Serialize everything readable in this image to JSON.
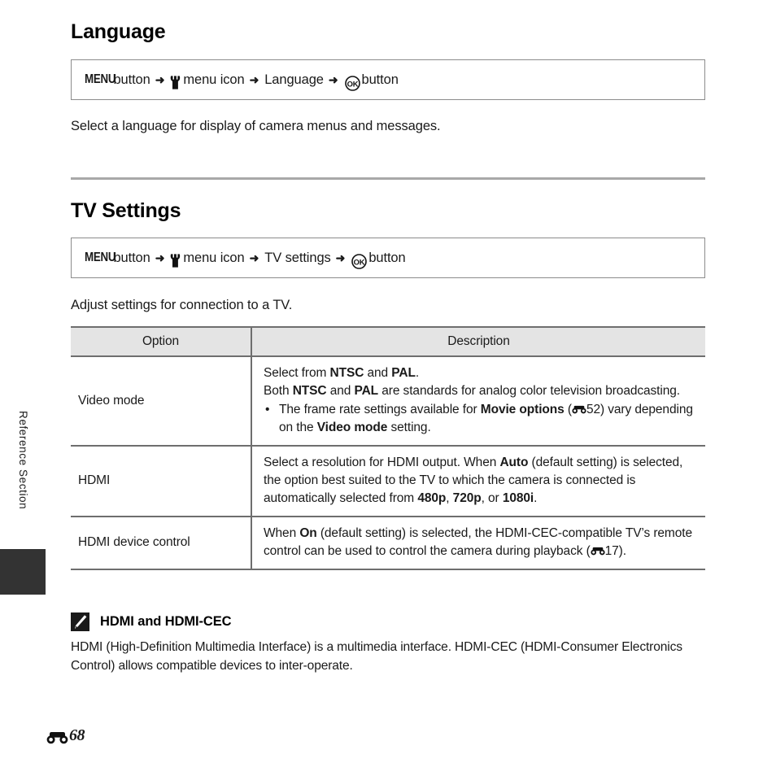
{
  "page": {
    "side_label": "Reference Section",
    "footer_page_number": "68",
    "footer_ref_icon": "reference-section-icon"
  },
  "sections": [
    {
      "id": "language",
      "title": "Language",
      "path": {
        "menu_label": "MENU",
        "button_word_1": "button",
        "wrench_icon": "setup-menu-wrench-icon",
        "menu_icon_label": "menu icon",
        "item_label": "Language",
        "ok_icon": "ok-button-icon",
        "button_word_2": "button",
        "arrow": "➜"
      },
      "description": "Select a language for display of camera menus and messages."
    },
    {
      "id": "tv-settings",
      "title": "TV Settings",
      "path": {
        "menu_label": "MENU",
        "button_word_1": "button",
        "wrench_icon": "setup-menu-wrench-icon",
        "menu_icon_label": "menu icon",
        "item_label": "TV settings",
        "ok_icon": "ok-button-icon",
        "button_word_2": "button",
        "arrow": "➜"
      },
      "description": "Adjust settings for connection to a TV."
    }
  ],
  "table": {
    "headers": [
      "Option",
      "Description"
    ],
    "rows": [
      {
        "option": "Video mode",
        "description_lines": [
          {
            "type": "para",
            "runs": [
              {
                "t": "Select from ",
                "b": false
              },
              {
                "t": "NTSC",
                "b": true
              },
              {
                "t": " and ",
                "b": false
              },
              {
                "t": "PAL",
                "b": true
              },
              {
                "t": ".",
                "b": false
              }
            ]
          },
          {
            "type": "para",
            "runs": [
              {
                "t": "Both ",
                "b": false
              },
              {
                "t": "NTSC",
                "b": true
              },
              {
                "t": " and ",
                "b": false
              },
              {
                "t": "PAL",
                "b": true
              },
              {
                "t": " are standards for analog color television broadcasting.",
                "b": false
              }
            ]
          },
          {
            "type": "bullet",
            "runs": [
              {
                "t": "The frame rate settings available for ",
                "b": false
              },
              {
                "t": "Movie options",
                "b": true
              },
              {
                "t": " (",
                "b": false
              },
              {
                "t": "ICON:reference-section-icon",
                "b": false
              },
              {
                "t": "52) vary depending on the ",
                "b": false
              },
              {
                "t": "Video mode",
                "b": true
              },
              {
                "t": " setting.",
                "b": false
              }
            ]
          }
        ]
      },
      {
        "option": "HDMI",
        "description_lines": [
          {
            "type": "para",
            "runs": [
              {
                "t": "Select a resolution for HDMI output. When ",
                "b": false
              },
              {
                "t": "Auto",
                "b": true
              },
              {
                "t": " (default setting) is selected, the option best suited to the TV to which the camera is connected is automatically selected from ",
                "b": false
              },
              {
                "t": "480p",
                "b": true
              },
              {
                "t": ", ",
                "b": false
              },
              {
                "t": "720p",
                "b": true
              },
              {
                "t": ", or ",
                "b": false
              },
              {
                "t": "1080i",
                "b": true
              },
              {
                "t": ".",
                "b": false
              }
            ]
          }
        ]
      },
      {
        "option": "HDMI device control",
        "description_lines": [
          {
            "type": "para",
            "runs": [
              {
                "t": "When ",
                "b": false
              },
              {
                "t": "On",
                "b": true
              },
              {
                "t": " (default setting) is selected, the HDMI-CEC-compatible TV’s remote control can be used to control the camera during playback (",
                "b": false
              },
              {
                "t": "ICON:reference-section-icon",
                "b": false
              },
              {
                "t": "17).",
                "b": false
              }
            ]
          }
        ]
      }
    ]
  },
  "note": {
    "icon": "pencil-note-icon",
    "title": "HDMI and HDMI-CEC",
    "body": "HDMI (High-Definition Multimedia Interface) is a multimedia interface. HDMI-CEC (HDMI-Consumer Electronics Control) allows compatible devices to inter-operate."
  },
  "colors": {
    "rule": "#a8a8a8",
    "table_border": "#6e6e6e",
    "table_header_bg": "#e4e4e4",
    "tab_block": "#333333",
    "text": "#1a1a1a"
  }
}
